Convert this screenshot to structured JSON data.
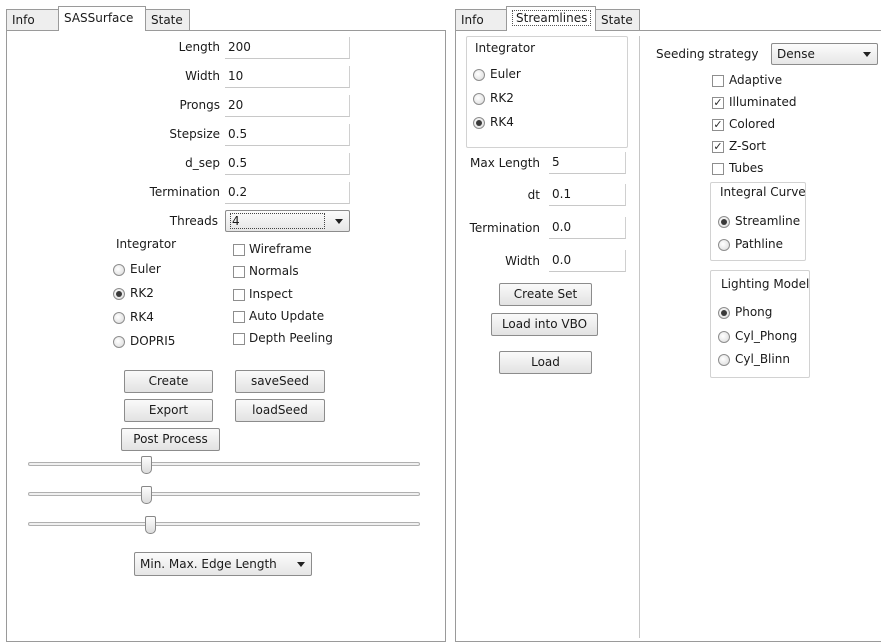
{
  "left": {
    "tabs": [
      "Info",
      "SASSurface",
      "State"
    ],
    "fields": [
      {
        "label": "Length",
        "value": "200"
      },
      {
        "label": "Width",
        "value": "10"
      },
      {
        "label": "Prongs",
        "value": "20"
      },
      {
        "label": "Stepsize",
        "value": "0.5"
      },
      {
        "label": "d_sep",
        "value": "0.5"
      },
      {
        "label": "Termination",
        "value": "0.2"
      }
    ],
    "threads_label": "Threads",
    "threads_value": "4",
    "integrator_title": "Integrator",
    "integrator_options": [
      "Euler",
      "RK2",
      "RK4",
      "DOPRI5"
    ],
    "integrator_selected": "RK2",
    "checks": [
      {
        "label": "Wireframe",
        "checked": false
      },
      {
        "label": "Normals",
        "checked": false
      },
      {
        "label": "Inspect",
        "checked": false
      },
      {
        "label": "Auto Update",
        "checked": false
      },
      {
        "label": "Depth Peeling",
        "checked": false
      }
    ],
    "buttons": {
      "create": "Create",
      "save_seed": "saveSeed",
      "export": "Export",
      "load_seed": "loadSeed",
      "post_process": "Post Process"
    },
    "slider_levels": [
      0.25,
      0.25,
      0.26
    ],
    "edge_combo": "Min. Max. Edge Length"
  },
  "right": {
    "tabs": [
      "Info",
      "Streamlines",
      "State"
    ],
    "integrator_title": "Integrator",
    "integrator_options": [
      "Euler",
      "RK2",
      "RK4"
    ],
    "integrator_selected": "RK4",
    "fields": [
      {
        "label": "Max Length",
        "value": "5"
      },
      {
        "label": "dt",
        "value": "0.1"
      },
      {
        "label": "Termination",
        "value": "0.0"
      },
      {
        "label": "Width",
        "value": "0.0"
      }
    ],
    "buttons": {
      "create_set": "Create Set",
      "load_into_vbo": "Load into VBO",
      "load": "Load"
    },
    "seeding_label": "Seeding strategy",
    "seeding_value": "Dense",
    "checks": [
      {
        "label": "Adaptive",
        "checked": false
      },
      {
        "label": "Illuminated",
        "checked": true
      },
      {
        "label": "Colored",
        "checked": true
      },
      {
        "label": "Z-Sort",
        "checked": true
      },
      {
        "label": "Tubes",
        "checked": false
      }
    ],
    "integral_curve_title": "Integral Curve",
    "integral_curve_options": [
      "Streamline",
      "Pathline"
    ],
    "integral_curve_selected": "Streamline",
    "lighting_title": "Lighting Model",
    "lighting_options": [
      "Phong",
      "Cyl_Phong",
      "Cyl_Blinn"
    ],
    "lighting_selected": "Phong"
  },
  "icons": {
    "check_mark": "✓"
  }
}
